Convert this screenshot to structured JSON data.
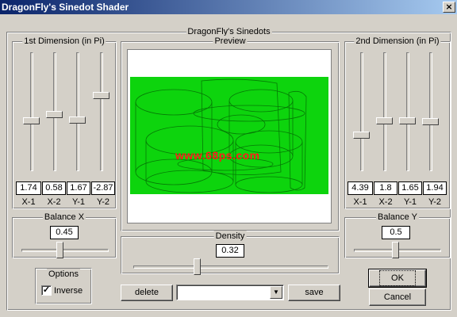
{
  "window": {
    "title": "DragonFly's Sinedot Shader",
    "close_glyph": "×"
  },
  "main_group": {
    "label": "DragonFly's Sinedots"
  },
  "dim1": {
    "label": "1st Dimension (in Pi)",
    "sliders": [
      {
        "label": "X-1",
        "value": "1.74"
      },
      {
        "label": "X-2",
        "value": "0.58"
      },
      {
        "label": "Y-1",
        "value": "1.67"
      },
      {
        "label": "Y-2",
        "value": "-2.87"
      }
    ]
  },
  "dim2": {
    "label": "2nd Dimension (in Pi)",
    "sliders": [
      {
        "label": "X-1",
        "value": "4.39"
      },
      {
        "label": "X-2",
        "value": "1.8"
      },
      {
        "label": "Y-1",
        "value": "1.65"
      },
      {
        "label": "Y-2",
        "value": "1.94"
      }
    ]
  },
  "preview": {
    "label": "Preview",
    "watermark": "www.68ps.com",
    "fill_color": "#0dd40d"
  },
  "balance_x": {
    "label": "Balance X",
    "value": "0.45"
  },
  "balance_y": {
    "label": "Balance Y",
    "value": "0.5"
  },
  "density": {
    "label": "Density",
    "value": "0.32"
  },
  "options": {
    "label": "Options",
    "inverse_label": "Inverse",
    "inverse_checked": true
  },
  "buttons": {
    "delete": "delete",
    "save": "save",
    "ok": "OK",
    "cancel": "Cancel"
  },
  "preset": {
    "value": ""
  },
  "colors": {
    "dialog_bg": "#d4d0c8",
    "title_start": "#0a246a",
    "title_end": "#a6caf0",
    "watermark": "#ff1a1a"
  }
}
